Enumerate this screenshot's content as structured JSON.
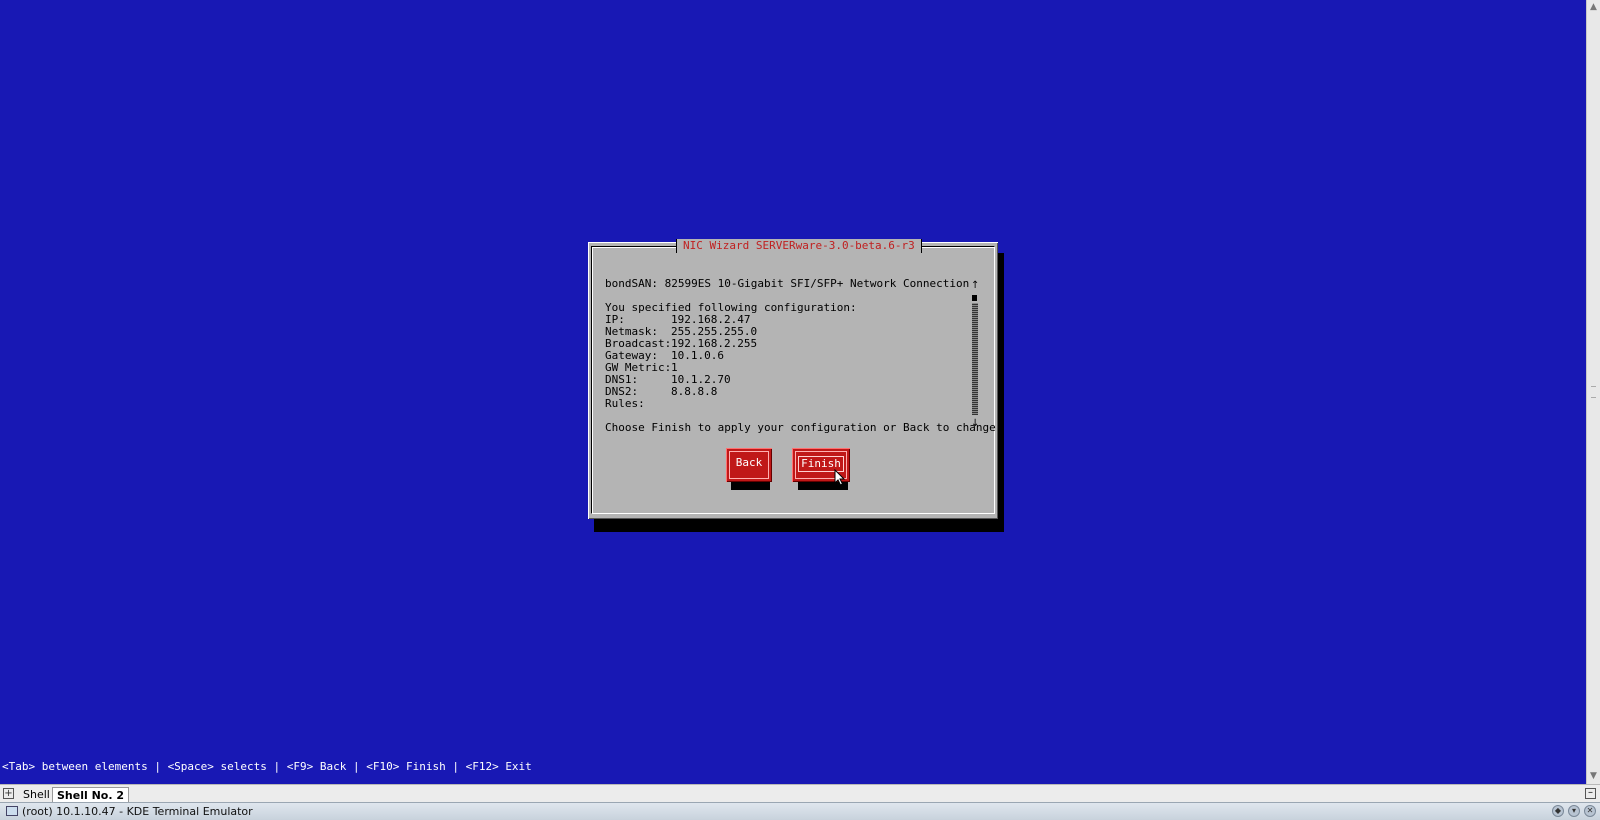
{
  "dialog": {
    "title": "NIC Wizard SERVERware-3.0-beta.6-r3",
    "device_line": "bondSAN: 82599ES 10-Gigabit SFI/SFP+ Network Connection",
    "intro": "You specified following configuration:",
    "config": [
      {
        "label": "IP:",
        "value": "192.168.2.47"
      },
      {
        "label": "Netmask:",
        "value": "255.255.255.0"
      },
      {
        "label": "Broadcast:",
        "value": "192.168.2.255"
      },
      {
        "label": "Gateway:",
        "value": "10.1.0.6"
      },
      {
        "label": "GW Metric:",
        "value": "1"
      },
      {
        "label": "DNS1:",
        "value": "10.1.2.70"
      },
      {
        "label": "DNS2:",
        "value": "8.8.8.8"
      },
      {
        "label": "Rules:",
        "value": ""
      }
    ],
    "footer": "Choose Finish to apply your configuration or Back to change.",
    "scroll_up": "↑",
    "scroll_down": "↓",
    "buttons": {
      "back": "Back",
      "finish": "Finish"
    }
  },
  "hint_bar": "<Tab> between elements | <Space> selects | <F9> Back | <F10> Finish | <F12> Exit",
  "tabs": [
    {
      "label": "Shell",
      "active": false
    },
    {
      "label": "Shell No. 2",
      "active": true
    }
  ],
  "taskbar": {
    "window_title": "(root) 10.1.10.47 - KDE Terminal Emulator"
  },
  "colors": {
    "terminal_bg": "#1818b4",
    "dialog_bg": "#b4b4b4",
    "button": "#c01818",
    "title": "#c02020"
  }
}
